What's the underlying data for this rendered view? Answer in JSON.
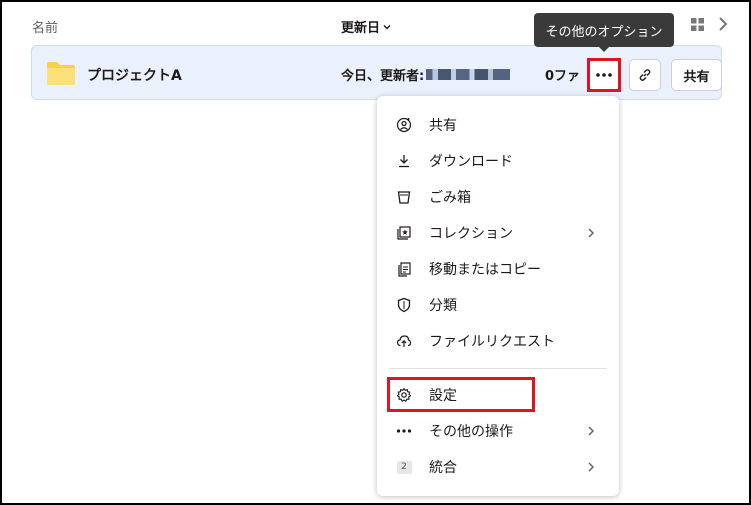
{
  "header": {
    "name_col": "名前",
    "modified_col": "更新日",
    "grid_icon": "grid-icon",
    "next_icon": "chevron-right-icon"
  },
  "tooltip": {
    "text": "その他のオプション"
  },
  "row": {
    "name": "プロジェクトA",
    "modified": "今日、更新者:",
    "files": "0ファ",
    "share_label": "共有",
    "more_icon": "more-horizontal-icon",
    "link_icon": "link-icon",
    "folder_icon": "folder-icon",
    "folder_color": "#f7d14c"
  },
  "menu": {
    "items": [
      {
        "label": "共有",
        "icon": "share-person-icon"
      },
      {
        "label": "ダウンロード",
        "icon": "download-icon"
      },
      {
        "label": "ごみ箱",
        "icon": "trash-icon"
      },
      {
        "label": "コレクション",
        "icon": "collection-icon",
        "submenu": true
      },
      {
        "label": "移動またはコピー",
        "icon": "copy-icon"
      },
      {
        "label": "分類",
        "icon": "shield-icon"
      },
      {
        "label": "ファイルリクエスト",
        "icon": "cloud-upload-icon"
      },
      {
        "label": "設定",
        "icon": "gear-icon"
      },
      {
        "label": "その他の操作",
        "icon": "more-horizontal-icon",
        "submenu": true
      },
      {
        "label": "統合",
        "icon": "integration-badge-icon",
        "badge": "2",
        "submenu": true
      }
    ]
  },
  "colors": {
    "highlight": "#e0141e",
    "row_bg": "#eaf1fc",
    "tooltip_bg": "#3a3a3a"
  }
}
